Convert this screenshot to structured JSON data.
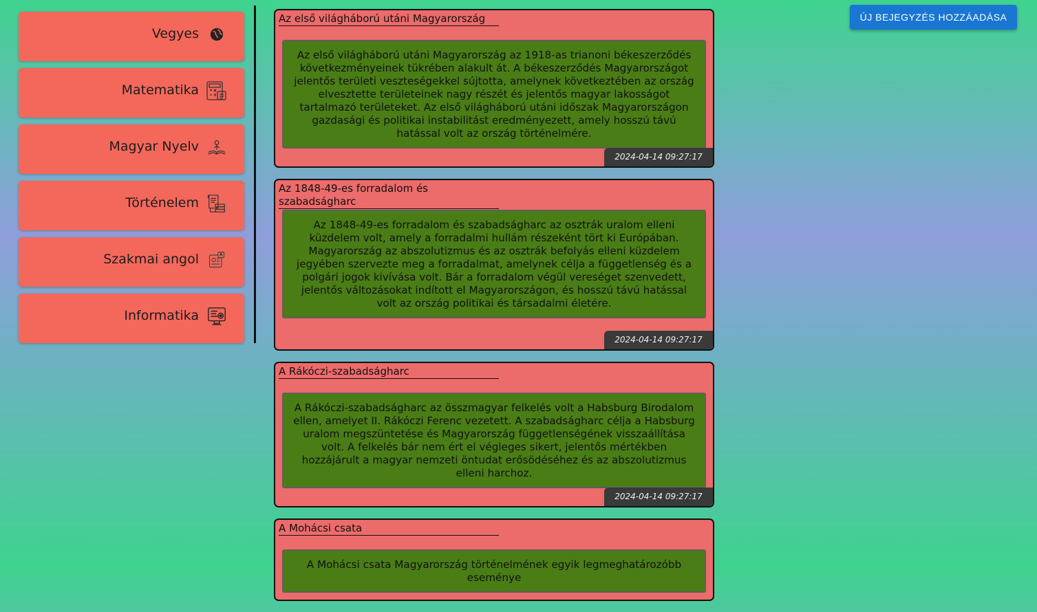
{
  "header": {
    "add_button_label": "ÚJ BEJEGYZÉS HOZZÁADÁSA"
  },
  "sidebar": {
    "items": [
      {
        "label": "Vegyes",
        "icon": "globe-icon"
      },
      {
        "label": "Matematika",
        "icon": "calculator-icon"
      },
      {
        "label": "Magyar Nyelv",
        "icon": "open-book-icon"
      },
      {
        "label": "Történelem",
        "icon": "scroll-books-icon"
      },
      {
        "label": "Szakmai angol",
        "icon": "language-card-icon"
      },
      {
        "label": "Informatika",
        "icon": "computer-monitor-icon"
      }
    ]
  },
  "posts": [
    {
      "title": "Az első világháború utáni Magyarország",
      "body": "Az első világháború utáni Magyarország az 1918-as trianoni békeszerződés következményeinek tükrében alakult át. A békeszerződés Magyarországot jelentős területi veszteségekkel sújtotta, amelynek következtében az ország elvesztette területeinek nagy részét és jelentős magyar lakosságot tartalmazó területeket. Az első világháború utáni időszak Magyarországon gazdasági és politikai instabilitást eredményezett, amely hosszú távú hatással volt az ország történelmére.",
      "date": "2024-04-14 09:27:17"
    },
    {
      "title": "Az 1848-49-es forradalom és szabadságharc",
      "body": "Az 1848-49-es forradalom és szabadságharc az osztrák uralom elleni küzdelem volt, amely a forradalmi hullám részeként tört ki Európában. Magyarország az abszolutizmus és az osztrák befolyás elleni küzdelem jegyében szervezte meg a forradalmat, amelynek célja a függetlenség és a polgári jogok kivívása volt. Bár a forradalom végül vereséget szenvedett, jelentős változásokat indított el Magyarországon, és hosszú távú hatással volt az ország politikai és társadalmi életére.",
      "date": "2024-04-14 09:27:17"
    },
    {
      "title": "A Rákóczi-szabadságharc",
      "body": "A Rákóczi-szabadságharc az összmagyar felkelés volt a Habsburg Birodalom ellen, amelyet II. Rákóczi Ferenc vezetett. A szabadságharc célja a Habsburg uralom megszüntetése és Magyarország függetlenségének visszaállítása volt. A felkelés bár nem ért el végleges sikert, jelentős mértékben hozzájárult a magyar nemzeti öntudat erősödéséhez és az abszolutizmus elleni harchoz.",
      "date": "2024-04-14 09:27:17"
    },
    {
      "title": "A Mohácsi csata",
      "body": "A Mohácsi csata Magyarország történelmének egyik legmeghatározóbb eseménye",
      "date": ""
    }
  ]
}
